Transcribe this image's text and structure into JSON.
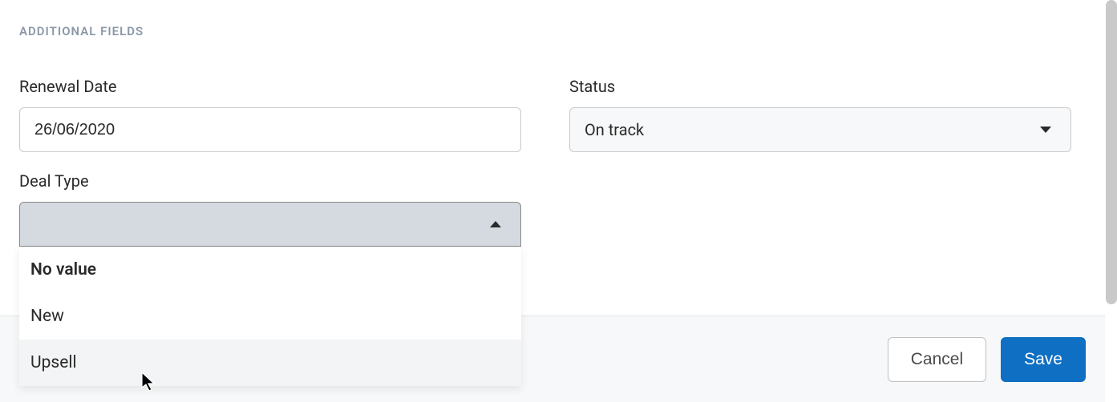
{
  "section_heading": "ADDITIONAL FIELDS",
  "fields": {
    "renewal_date": {
      "label": "Renewal Date",
      "value": "26/06/2020"
    },
    "status": {
      "label": "Status",
      "value": "On track"
    },
    "deal_type": {
      "label": "Deal Type",
      "options": [
        "No value",
        "New",
        "Upsell"
      ]
    }
  },
  "footer": {
    "cancel_label": "Cancel",
    "save_label": "Save"
  }
}
